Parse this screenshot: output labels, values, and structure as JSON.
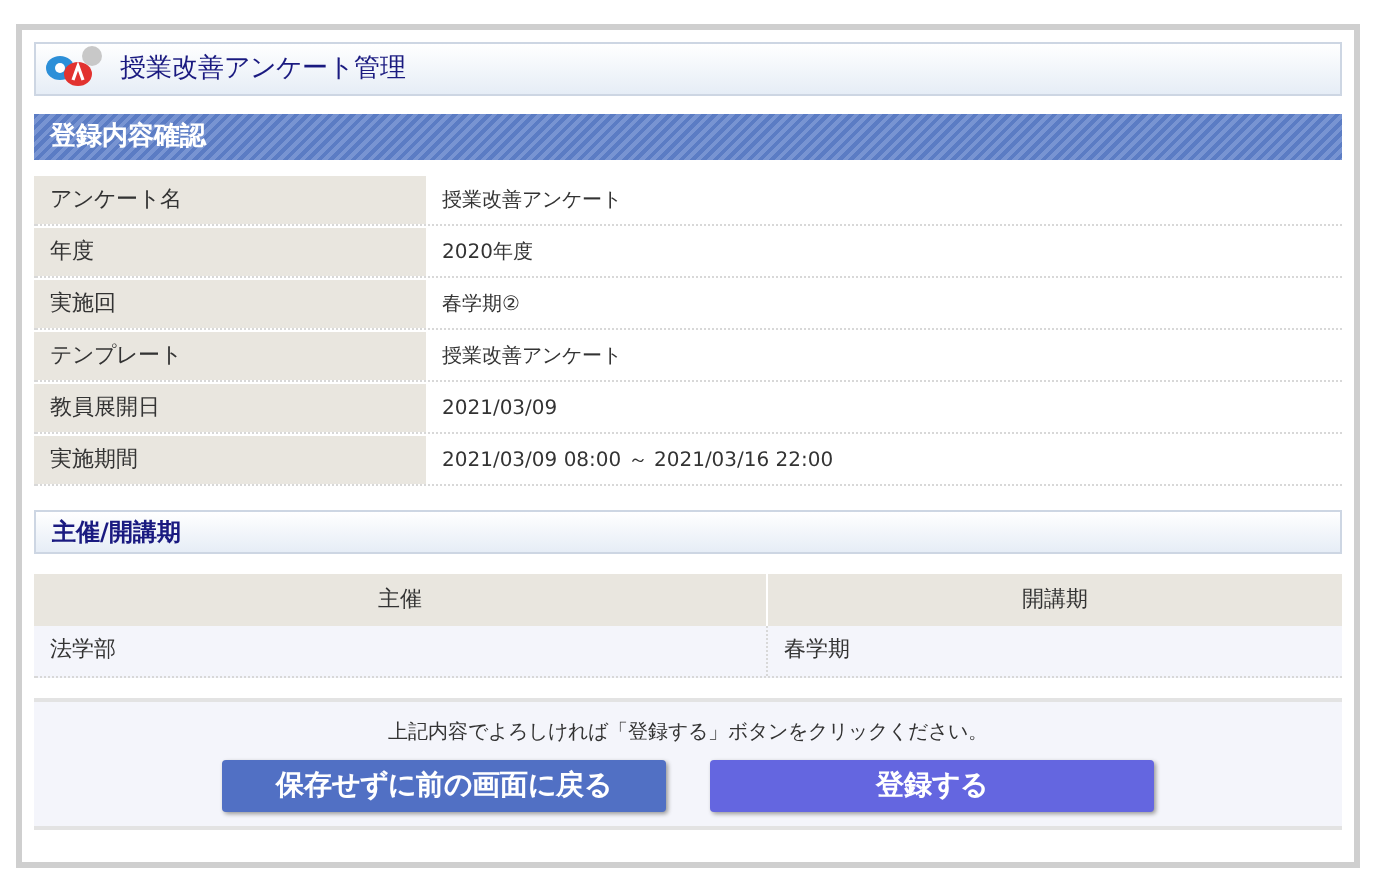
{
  "page_title": "授業改善アンケート管理",
  "section_confirm": {
    "title": "登録内容確認",
    "rows": [
      {
        "label": "アンケート名",
        "value": "授業改善アンケート"
      },
      {
        "label": "年度",
        "value": "2020年度"
      },
      {
        "label": "実施回",
        "value": "春学期②"
      },
      {
        "label": "テンプレート",
        "value": "授業改善アンケート"
      },
      {
        "label": "教員展開日",
        "value": "2021/03/09"
      },
      {
        "label": "実施期間",
        "value": "2021/03/09 08:00 ～ 2021/03/16 22:00"
      }
    ]
  },
  "section_host": {
    "title": "主催/開講期",
    "columns": [
      "主催",
      "開講期"
    ],
    "rows": [
      [
        "法学部",
        "春学期"
      ]
    ]
  },
  "footer": {
    "message": "上記内容でよろしければ「登録する」ボタンをクリックください。",
    "buttons": [
      {
        "label": "保存せずに前の画面に戻る",
        "kind": "back"
      },
      {
        "label": "登録する",
        "kind": "submit"
      }
    ]
  }
}
